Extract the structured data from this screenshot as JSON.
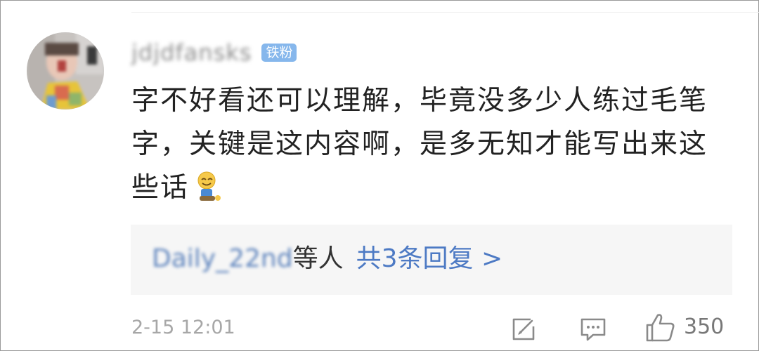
{
  "comment": {
    "username": "jdjdfansks",
    "badge": "铁粉",
    "text": "字不好看还可以理解，毕竟没多少人练过毛笔字，关键是这内容啊，是多无知才能写出来这些话",
    "emoji": "kneeling-smile-emoji"
  },
  "replies": {
    "first_user": "Daily_22nd",
    "others_label": "等人",
    "count_label": "共3条回复 >"
  },
  "footer": {
    "timestamp": "2-15 12:01",
    "like_count": "350"
  },
  "icons": {
    "edit": "edit-icon",
    "comment": "comment-icon",
    "like": "thumbs-up-icon"
  },
  "colors": {
    "badge": "#86b7ec",
    "link": "#4d7ac4",
    "reply_bg": "#f6f6f6",
    "muted": "#a7a7a7"
  }
}
